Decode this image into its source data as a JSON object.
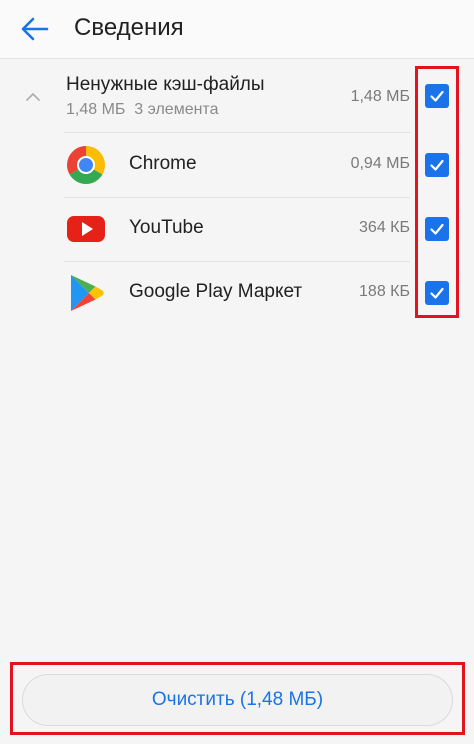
{
  "header": {
    "title": "Сведения",
    "back_icon": "arrow-left-icon"
  },
  "group": {
    "title": "Ненужные кэш-файлы",
    "subtitle": "1,48 МБ  3 элемента",
    "size": "1,48 МБ",
    "checked": true,
    "expand_icon": "chevron-up-icon"
  },
  "apps": [
    {
      "name": "Chrome",
      "size": "0,94 МБ",
      "checked": true,
      "icon": "chrome-icon"
    },
    {
      "name": "YouTube",
      "size": "364 КБ",
      "checked": true,
      "icon": "youtube-icon"
    },
    {
      "name": "Google Play Маркет",
      "size": "188 КБ",
      "checked": true,
      "icon": "google-play-icon"
    }
  ],
  "footer": {
    "clear_label": "Очистить (1,48 МБ)"
  },
  "colors": {
    "accent": "#1a73e8",
    "highlight": "#e3121f",
    "background": "#f5f5f5"
  }
}
